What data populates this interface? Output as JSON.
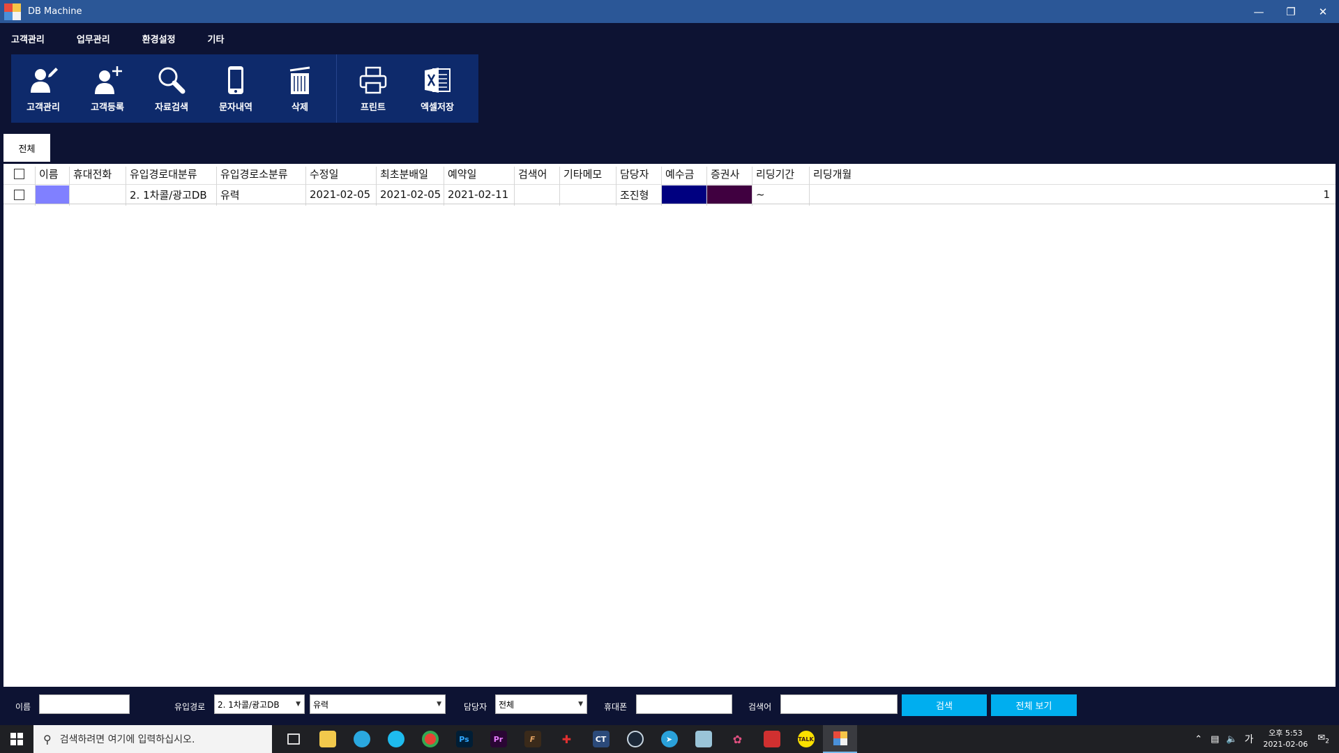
{
  "window": {
    "title": "DB Machine"
  },
  "menu": [
    "고객관리",
    "업무관리",
    "환경설정",
    "기타"
  ],
  "toolbar": {
    "group1": [
      {
        "label": "고객관리",
        "icon": "user-edit-icon"
      },
      {
        "label": "고객등록",
        "icon": "user-add-icon"
      },
      {
        "label": "자료검색",
        "icon": "search-icon"
      },
      {
        "label": "문자내역",
        "icon": "phone-icon"
      },
      {
        "label": "삭제",
        "icon": "trash-icon"
      }
    ],
    "group2": [
      {
        "label": "프린트",
        "icon": "printer-icon"
      },
      {
        "label": "엑셀저장",
        "icon": "excel-icon"
      }
    ]
  },
  "tab": {
    "label": "전체"
  },
  "grid": {
    "columns": [
      "이름",
      "휴대전화",
      "유입경로대분류",
      "유입경로소분류",
      "수정일",
      "최초분배일",
      "예약일",
      "검색어",
      "기타메모",
      "담당자",
      "예수금",
      "증권사",
      "리딩기간",
      "리딩개월"
    ],
    "rows": [
      {
        "name_color": "#8080ff",
        "phone": "",
        "source_major": "2. 1차콜/광고DB",
        "source_minor": "유력",
        "modified": "2021-02-05",
        "first_assigned": "2021-02-05",
        "reserved": "2021-02-11",
        "keyword": "",
        "memo": "",
        "manager": "조진형",
        "deposit_color": "#000080",
        "broker_color": "#400040",
        "period": "~",
        "months": "",
        "count": "1"
      }
    ]
  },
  "search": {
    "name_label": "이름",
    "name_value": "",
    "source_label": "유입경로",
    "source_major": "2. 1차콜/광고DB",
    "source_minor": "유력",
    "manager_label": "담당자",
    "manager_value": "전체",
    "phone_label": "휴대폰",
    "phone_value": "",
    "keyword_label": "검색어",
    "keyword_value": "",
    "search_button": "검색",
    "show_all_button": "전체 보기"
  },
  "taskbar": {
    "search_placeholder": "검색하려면 여기에 입력하십시오.",
    "clock_time": "오후 5:53",
    "clock_date": "2021-02-06",
    "ime": "가",
    "notification_count": "2"
  },
  "colors": {
    "accent": "#00aeef",
    "titlebar": "#2b5797",
    "background": "#0d1333",
    "toolbar": "#0e2a6b"
  }
}
